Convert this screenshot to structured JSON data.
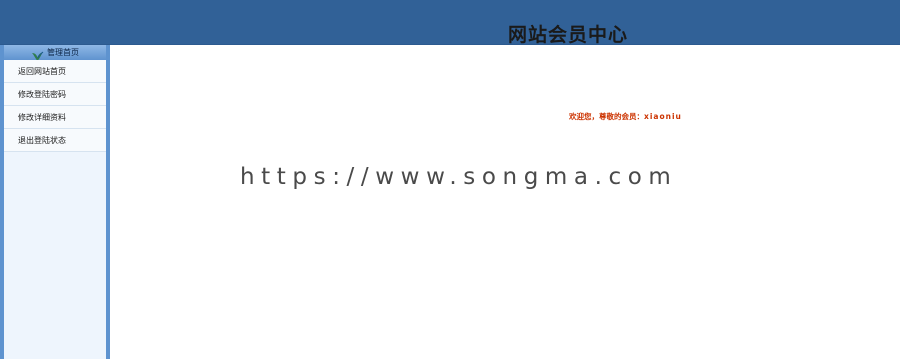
{
  "header": {
    "title": "网站会员中心"
  },
  "sidebar": {
    "header_label": "管理首页",
    "header_icon": "bird-logo-icon",
    "items": [
      {
        "label": "返回网站首页"
      },
      {
        "label": "修改登陆密码"
      },
      {
        "label": "修改详细资料"
      },
      {
        "label": "退出登陆状态"
      }
    ]
  },
  "main": {
    "welcome_prefix": "欢迎您，尊敬的会员：",
    "username": "xiaoniu"
  },
  "watermark": "https://www.songma.com",
  "colors": {
    "topbar": "#316197",
    "sidebar_border": "#5e93cf",
    "sidebar_bg": "#eef5fd",
    "welcome_text": "#cc3300"
  }
}
